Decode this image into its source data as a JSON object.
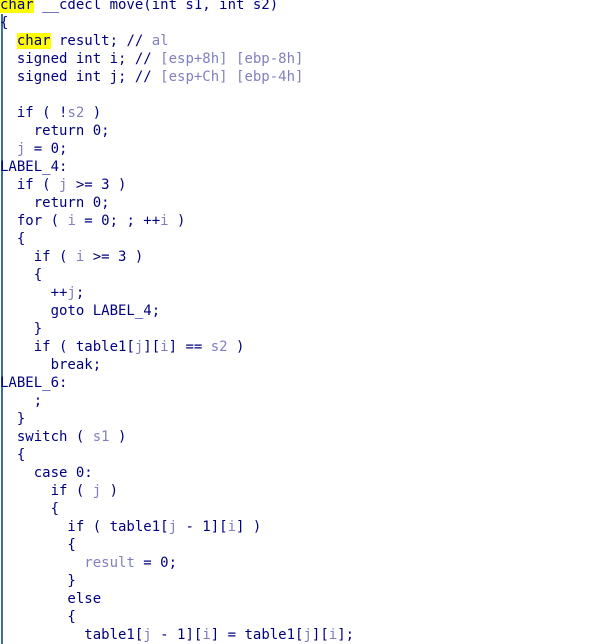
{
  "app": {
    "name": "hex-rays-pseudocode-view",
    "background_color": "#ffffff",
    "keyword_color": "#00007f",
    "variable_color": "#8080c0",
    "highlight_color": "#ffff00",
    "gutter_color": "#3a6ea5"
  },
  "code": {
    "function_name": "move",
    "lines": [
      {
        "id": "line-signature",
        "clipped_top": true,
        "tokens": [
          {
            "t": "char",
            "c": "hl"
          },
          {
            "t": " __cdecl ",
            "c": "kw"
          },
          {
            "t": "move(int s1, int s2)",
            "c": "kw"
          }
        ]
      },
      {
        "id": "line-open-brace-func",
        "tokens": [
          {
            "t": "{",
            "c": "kw"
          }
        ]
      },
      {
        "id": "line-decl-result",
        "tokens": [
          {
            "t": "  ",
            "c": "kw"
          },
          {
            "t": "char",
            "c": "hl"
          },
          {
            "t": " result; ",
            "c": "kw"
          },
          {
            "t": "// ",
            "c": "comment"
          },
          {
            "t": "al",
            "c": "cmttext"
          }
        ]
      },
      {
        "id": "line-decl-i",
        "tokens": [
          {
            "t": "  signed int i; ",
            "c": "kw"
          },
          {
            "t": "// ",
            "c": "comment"
          },
          {
            "t": "[esp+8h] [ebp-8h]",
            "c": "cmttext"
          }
        ]
      },
      {
        "id": "line-decl-j",
        "tokens": [
          {
            "t": "  signed int j; ",
            "c": "kw"
          },
          {
            "t": "// ",
            "c": "comment"
          },
          {
            "t": "[esp+Ch] [ebp-4h]",
            "c": "cmttext"
          }
        ]
      },
      {
        "id": "line-blank-1",
        "tokens": [
          {
            "t": "",
            "c": "kw"
          }
        ]
      },
      {
        "id": "line-if-not-s2",
        "tokens": [
          {
            "t": "  if ( !",
            "c": "kw"
          },
          {
            "t": "s2",
            "c": "var"
          },
          {
            "t": " )",
            "c": "kw"
          }
        ]
      },
      {
        "id": "line-return-0-a",
        "tokens": [
          {
            "t": "    return 0;",
            "c": "kw"
          }
        ]
      },
      {
        "id": "line-j-assign-0",
        "tokens": [
          {
            "t": "  ",
            "c": "kw"
          },
          {
            "t": "j",
            "c": "var"
          },
          {
            "t": " = 0;",
            "c": "kw"
          }
        ]
      },
      {
        "id": "line-label-4",
        "tokens": [
          {
            "t": "LABEL_4:",
            "c": "label"
          }
        ]
      },
      {
        "id": "line-if-j-ge-3",
        "tokens": [
          {
            "t": "  if ( ",
            "c": "kw"
          },
          {
            "t": "j",
            "c": "var"
          },
          {
            "t": " >= 3 )",
            "c": "kw"
          }
        ]
      },
      {
        "id": "line-return-0-b",
        "tokens": [
          {
            "t": "    return 0;",
            "c": "kw"
          }
        ]
      },
      {
        "id": "line-for-i",
        "tokens": [
          {
            "t": "  for ( ",
            "c": "kw"
          },
          {
            "t": "i",
            "c": "var"
          },
          {
            "t": " = 0; ; ++",
            "c": "kw"
          },
          {
            "t": "i",
            "c": "var"
          },
          {
            "t": " )",
            "c": "kw"
          }
        ]
      },
      {
        "id": "line-open-brace-for",
        "tokens": [
          {
            "t": "  {",
            "c": "kw"
          }
        ]
      },
      {
        "id": "line-if-i-ge-3",
        "tokens": [
          {
            "t": "    if ( ",
            "c": "kw"
          },
          {
            "t": "i",
            "c": "var"
          },
          {
            "t": " >= 3 )",
            "c": "kw"
          }
        ]
      },
      {
        "id": "line-open-brace-if-i",
        "tokens": [
          {
            "t": "    {",
            "c": "kw"
          }
        ]
      },
      {
        "id": "line-increment-j",
        "tokens": [
          {
            "t": "      ++",
            "c": "kw"
          },
          {
            "t": "j",
            "c": "var"
          },
          {
            "t": ";",
            "c": "kw"
          }
        ]
      },
      {
        "id": "line-goto-label-4",
        "tokens": [
          {
            "t": "      goto LABEL_4;",
            "c": "kw"
          }
        ]
      },
      {
        "id": "line-close-brace-if-i",
        "tokens": [
          {
            "t": "    }",
            "c": "kw"
          }
        ]
      },
      {
        "id": "line-if-table-eq-s2",
        "tokens": [
          {
            "t": "    if ( table1[",
            "c": "kw"
          },
          {
            "t": "j",
            "c": "var"
          },
          {
            "t": "][",
            "c": "kw"
          },
          {
            "t": "i",
            "c": "var"
          },
          {
            "t": "] == ",
            "c": "kw"
          },
          {
            "t": "s2",
            "c": "var"
          },
          {
            "t": " )",
            "c": "kw"
          }
        ]
      },
      {
        "id": "line-break",
        "tokens": [
          {
            "t": "      break;",
            "c": "kw"
          }
        ]
      },
      {
        "id": "line-label-6",
        "tokens": [
          {
            "t": "LABEL_6:",
            "c": "label"
          }
        ]
      },
      {
        "id": "line-empty-statement",
        "tokens": [
          {
            "t": "    ;",
            "c": "kw"
          }
        ]
      },
      {
        "id": "line-close-brace-for",
        "tokens": [
          {
            "t": "  }",
            "c": "kw"
          }
        ]
      },
      {
        "id": "line-switch-s1",
        "tokens": [
          {
            "t": "  switch ( ",
            "c": "kw"
          },
          {
            "t": "s1",
            "c": "var"
          },
          {
            "t": " )",
            "c": "kw"
          }
        ]
      },
      {
        "id": "line-open-brace-switch",
        "tokens": [
          {
            "t": "  {",
            "c": "kw"
          }
        ]
      },
      {
        "id": "line-case-0",
        "tokens": [
          {
            "t": "    case 0:",
            "c": "kw"
          }
        ]
      },
      {
        "id": "line-if-j",
        "tokens": [
          {
            "t": "      if ( ",
            "c": "kw"
          },
          {
            "t": "j",
            "c": "var"
          },
          {
            "t": " )",
            "c": "kw"
          }
        ]
      },
      {
        "id": "line-open-brace-case0",
        "tokens": [
          {
            "t": "      {",
            "c": "kw"
          }
        ]
      },
      {
        "id": "line-if-table-jm1-i",
        "tokens": [
          {
            "t": "        if ( table1[",
            "c": "kw"
          },
          {
            "t": "j",
            "c": "var"
          },
          {
            "t": " - 1][",
            "c": "kw"
          },
          {
            "t": "i",
            "c": "var"
          },
          {
            "t": "] )",
            "c": "kw"
          }
        ]
      },
      {
        "id": "line-open-brace-inner-if",
        "tokens": [
          {
            "t": "        {",
            "c": "kw"
          }
        ]
      },
      {
        "id": "line-result-assign-0",
        "tokens": [
          {
            "t": "          ",
            "c": "kw"
          },
          {
            "t": "result",
            "c": "var"
          },
          {
            "t": " = 0;",
            "c": "kw"
          }
        ]
      },
      {
        "id": "line-close-brace-inner-if",
        "tokens": [
          {
            "t": "        }",
            "c": "kw"
          }
        ]
      },
      {
        "id": "line-else",
        "tokens": [
          {
            "t": "        else",
            "c": "kw"
          }
        ]
      },
      {
        "id": "line-open-brace-else",
        "tokens": [
          {
            "t": "        {",
            "c": "kw"
          }
        ]
      },
      {
        "id": "line-table-assign",
        "tokens": [
          {
            "t": "          table1[",
            "c": "kw"
          },
          {
            "t": "j",
            "c": "var"
          },
          {
            "t": " - 1][",
            "c": "kw"
          },
          {
            "t": "i",
            "c": "var"
          },
          {
            "t": "] = table1[",
            "c": "kw"
          },
          {
            "t": "j",
            "c": "var"
          },
          {
            "t": "][",
            "c": "kw"
          },
          {
            "t": "i",
            "c": "var"
          },
          {
            "t": "];",
            "c": "kw"
          }
        ]
      }
    ]
  }
}
